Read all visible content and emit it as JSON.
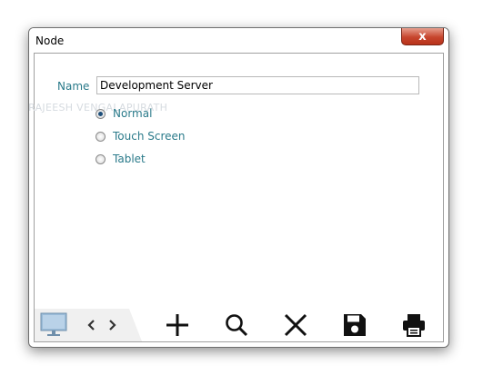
{
  "window": {
    "title": "Node",
    "close_glyph": "x"
  },
  "form": {
    "name_label": "Name",
    "name_value": "Development Server",
    "options": [
      {
        "label": "Normal",
        "selected": true
      },
      {
        "label": "Touch Screen",
        "selected": false
      },
      {
        "label": "Tablet",
        "selected": false
      }
    ]
  },
  "watermark": "© RAJEESH VENGALAPURATH",
  "toolbar": {
    "items": [
      "monitor-icon",
      "chevron-left-icon",
      "chevron-right-icon",
      "plus-icon",
      "search-icon",
      "close-icon",
      "save-icon",
      "print-icon"
    ]
  },
  "colors": {
    "label": "#2a7a8a",
    "close_button": "#c7462e",
    "monitor": "#9bbcd9"
  }
}
